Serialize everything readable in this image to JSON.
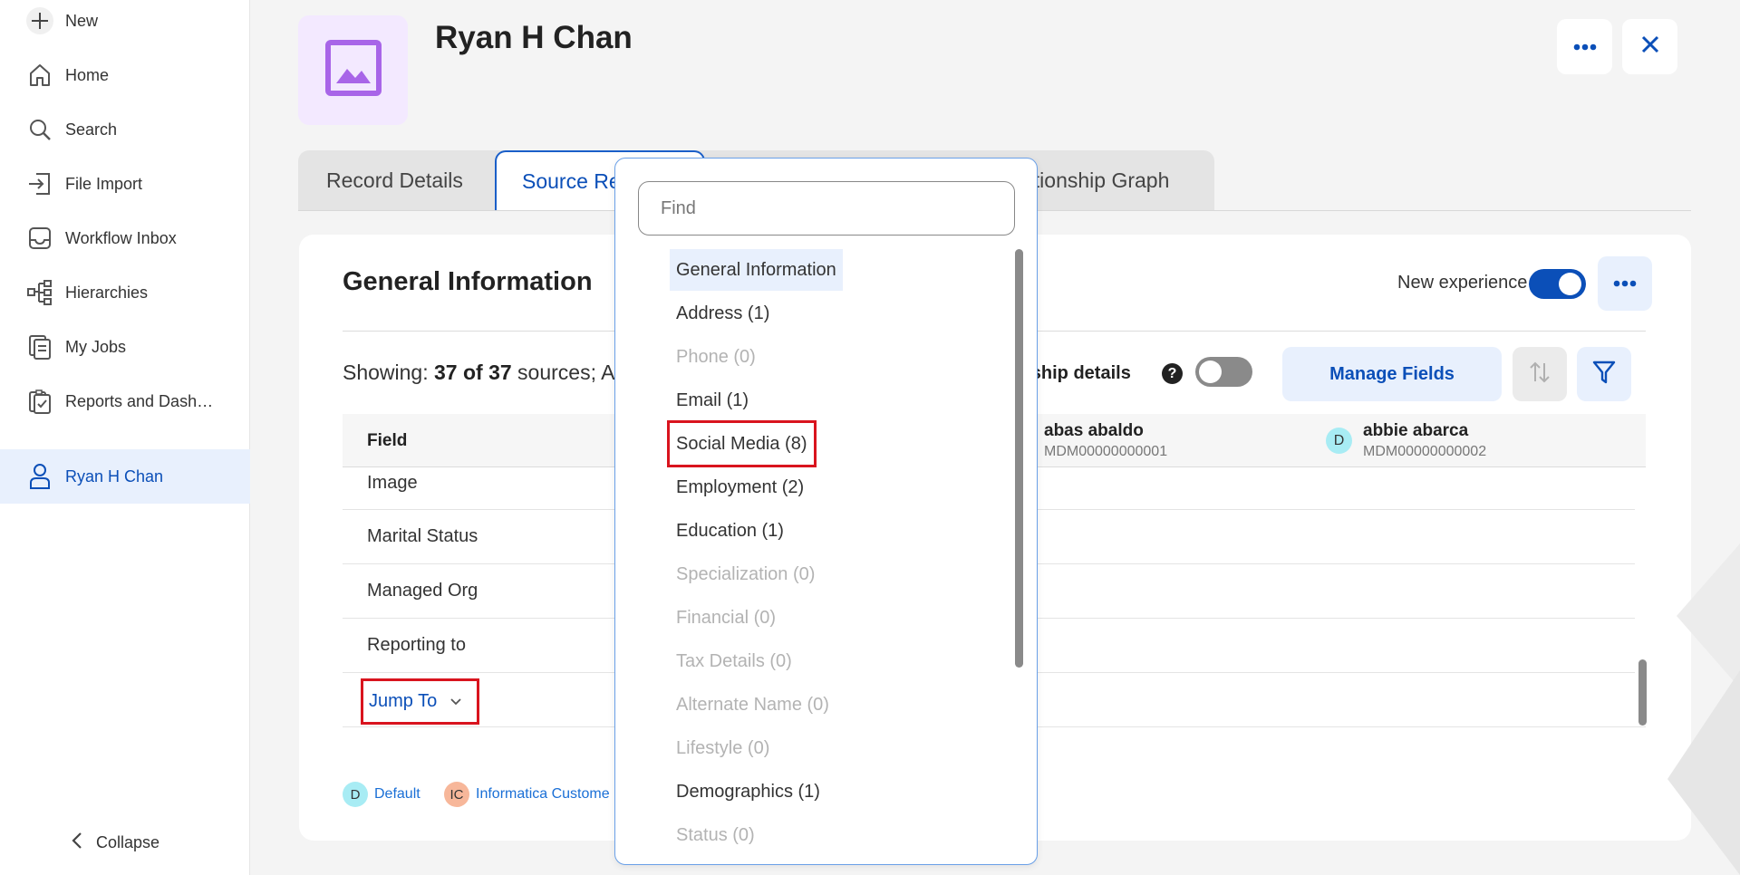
{
  "sidebar": {
    "new_label": "New",
    "items": [
      {
        "label": "Home",
        "icon": "home-icon"
      },
      {
        "label": "Search",
        "icon": "search-icon"
      },
      {
        "label": "File Import",
        "icon": "file-import-icon"
      },
      {
        "label": "Workflow Inbox",
        "icon": "inbox-icon"
      },
      {
        "label": "Hierarchies",
        "icon": "hierarchy-icon"
      },
      {
        "label": "My Jobs",
        "icon": "jobs-icon"
      },
      {
        "label": "Reports and Dash…",
        "icon": "reports-icon"
      },
      {
        "label": "Ryan H Chan",
        "icon": "person-icon"
      }
    ],
    "collapse_label": "Collapse"
  },
  "header": {
    "title": "Ryan H Chan"
  },
  "tabs": [
    {
      "label": "Record Details"
    },
    {
      "label": "Source Re"
    },
    {
      "label": "ationship Graph"
    }
  ],
  "card": {
    "section_title": "General Information",
    "new_experience_label": "New experience",
    "showing_prefix": "Showing: ",
    "showing_count": "37 of 37",
    "showing_suffix": " sources; A",
    "relationship_label": "rship details",
    "help_symbol": "?",
    "manage_fields_label": "Manage Fields",
    "table": {
      "field_header": "Field",
      "sources": [
        {
          "name": "abas abaldo",
          "id": "MDM00000000001",
          "badge": ""
        },
        {
          "name": "abbie abarca",
          "id": "MDM00000000002",
          "badge": "D"
        }
      ],
      "rows": [
        "Image",
        "Marital Status",
        "Managed Org",
        "Reporting to"
      ]
    },
    "jump_to_label": "Jump To",
    "legend": [
      {
        "badge": "D",
        "label": "Default",
        "color": "#a8ecf4"
      },
      {
        "badge": "IC",
        "label": "Informatica Custome",
        "color": "#f7b79a"
      }
    ]
  },
  "dropdown": {
    "find_placeholder": "Find",
    "items": [
      {
        "label": "General Information",
        "state": "highlight"
      },
      {
        "label": "Address (1)",
        "state": "enabled"
      },
      {
        "label": "Phone (0)",
        "state": "disabled"
      },
      {
        "label": "Email (1)",
        "state": "enabled"
      },
      {
        "label": "Social Media (8)",
        "state": "selected"
      },
      {
        "label": "Employment (2)",
        "state": "enabled"
      },
      {
        "label": "Education (1)",
        "state": "enabled"
      },
      {
        "label": "Specialization (0)",
        "state": "disabled"
      },
      {
        "label": "Financial (0)",
        "state": "disabled"
      },
      {
        "label": "Tax Details (0)",
        "state": "disabled"
      },
      {
        "label": "Alternate Name (0)",
        "state": "disabled"
      },
      {
        "label": "Lifestyle (0)",
        "state": "disabled"
      },
      {
        "label": "Demographics (1)",
        "state": "enabled"
      },
      {
        "label": "Status (0)",
        "state": "disabled"
      }
    ]
  },
  "colors": {
    "accent": "#0b4fb8",
    "highlight_outline": "#d9141e",
    "toggle_on": "#0b4fb8",
    "toggle_off": "#8a8a8a"
  }
}
